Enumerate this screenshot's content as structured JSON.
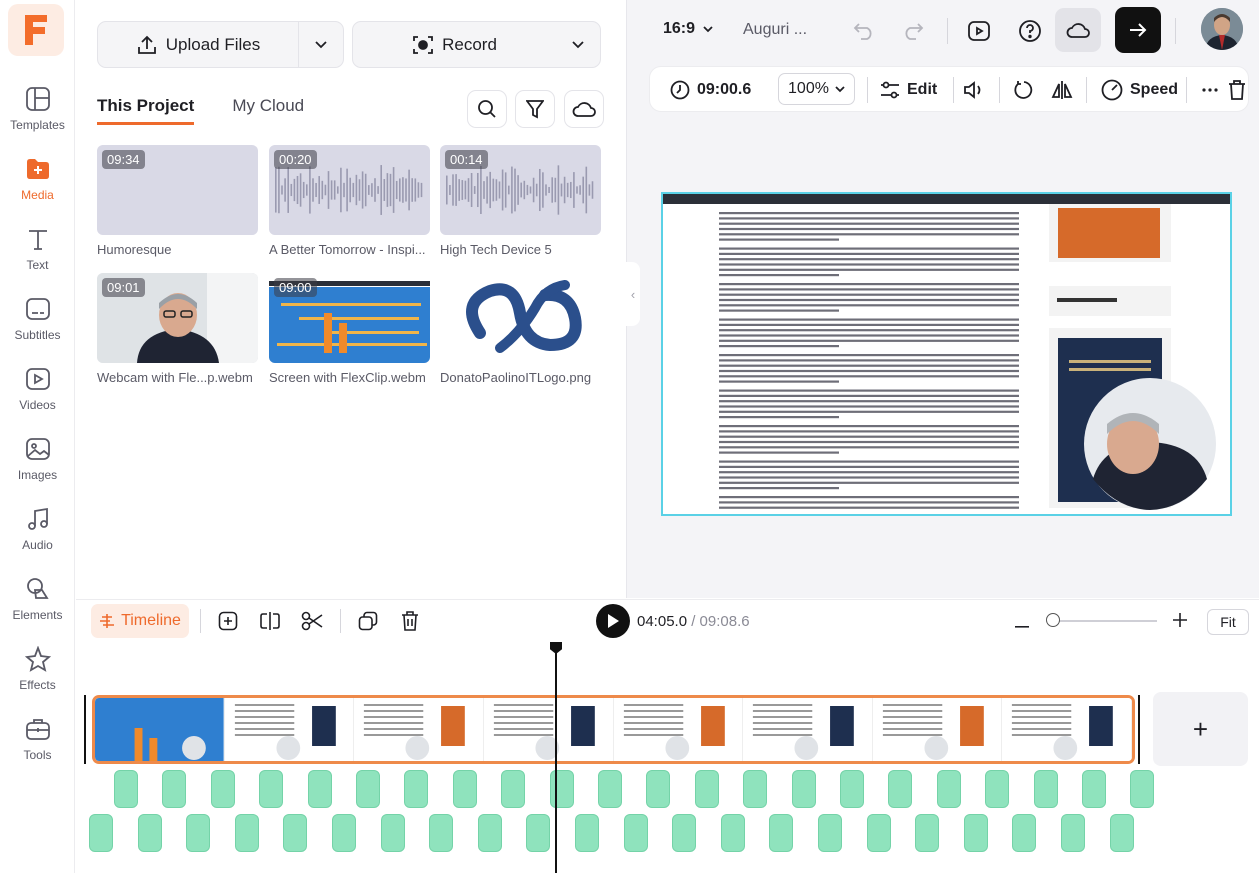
{
  "app": {
    "nav": [
      {
        "label": "Templates",
        "icon": "templates-icon"
      },
      {
        "label": "Media",
        "icon": "media-icon",
        "active": true
      },
      {
        "label": "Text",
        "icon": "text-icon"
      },
      {
        "label": "Subtitles",
        "icon": "subtitles-icon"
      },
      {
        "label": "Videos",
        "icon": "videos-icon"
      },
      {
        "label": "Images",
        "icon": "images-icon"
      },
      {
        "label": "Audio",
        "icon": "audio-icon"
      },
      {
        "label": "Elements",
        "icon": "elements-icon"
      },
      {
        "label": "Effects",
        "icon": "effects-icon"
      },
      {
        "label": "Tools",
        "icon": "tools-icon"
      }
    ]
  },
  "media": {
    "upload_label": "Upload Files",
    "record_label": "Record",
    "tabs": [
      {
        "label": "This Project",
        "active": true
      },
      {
        "label": "My Cloud",
        "active": false
      }
    ],
    "items": [
      {
        "name": "Humoresque",
        "duration": "09:34",
        "kind": "audio-blank"
      },
      {
        "name": "A Better Tomorrow - Inspi...",
        "duration": "00:20",
        "kind": "audio-wave"
      },
      {
        "name": "High Tech Device 5",
        "duration": "00:14",
        "kind": "audio-wave"
      },
      {
        "name": "Webcam with Fle...p.webm",
        "duration": "09:01",
        "kind": "webcam"
      },
      {
        "name": "Screen with FlexClip.webm",
        "duration": "09:00",
        "kind": "screen"
      },
      {
        "name": "DonatoPaolinoITLogo.png",
        "duration": "",
        "kind": "logo"
      }
    ]
  },
  "preview": {
    "aspect_ratio": "16:9",
    "project_title": "Auguri ...",
    "duration": "09:00.6",
    "zoom": "100%",
    "edit_label": "Edit",
    "speed_label": "Speed"
  },
  "timeline": {
    "toggle_label": "Timeline",
    "current_time": "04:05.0",
    "total_time": "/ 09:08.6",
    "fit_label": "Fit",
    "add_label": "+"
  },
  "colors": {
    "accent": "#ee6a2c",
    "selection": "#5ad1e6",
    "audio_clip": "#8fe3bd"
  }
}
